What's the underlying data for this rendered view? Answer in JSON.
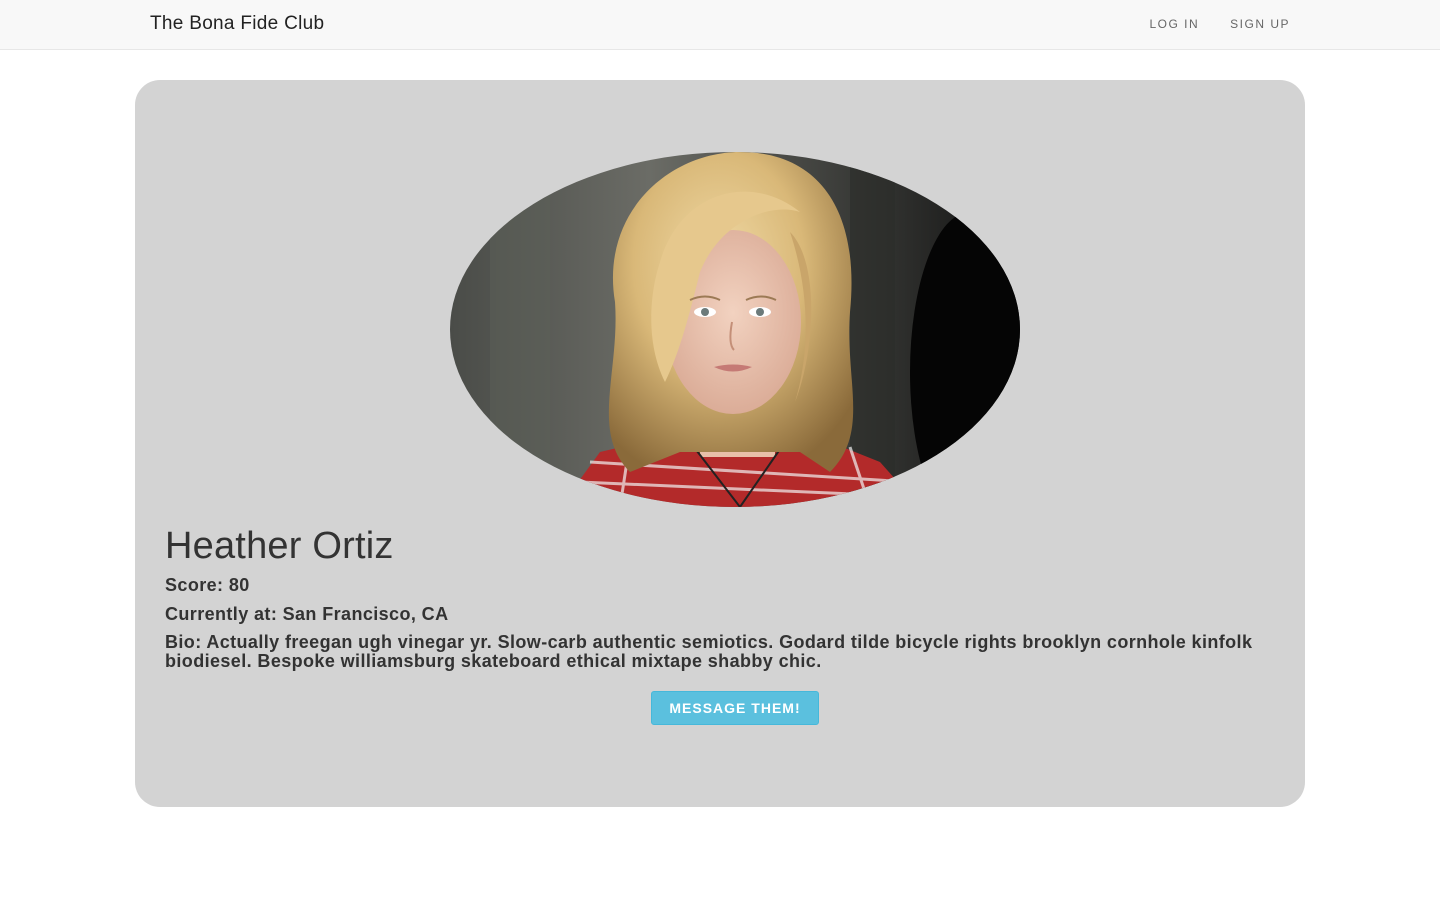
{
  "navbar": {
    "brand": "The Bona Fide Club",
    "links": [
      {
        "label": "LOG IN"
      },
      {
        "label": "SIGN UP"
      }
    ]
  },
  "profile": {
    "name": "Heather Ortiz",
    "score": "Score: 80",
    "location": "Currently at: San Francisco, CA",
    "bio": "Bio: Actually freegan ugh vinegar yr. Slow-carb authentic semiotics. Godard tilde bicycle rights brooklyn cornhole kinfolk biodiesel. Bespoke williamsburg skateboard ethical mixtape shabby chic.",
    "message_button": "MESSAGE THEM!"
  },
  "colors": {
    "card_background": "#d3d3d3",
    "button_background": "#5bc0de",
    "navbar_background": "#f8f8f8"
  }
}
